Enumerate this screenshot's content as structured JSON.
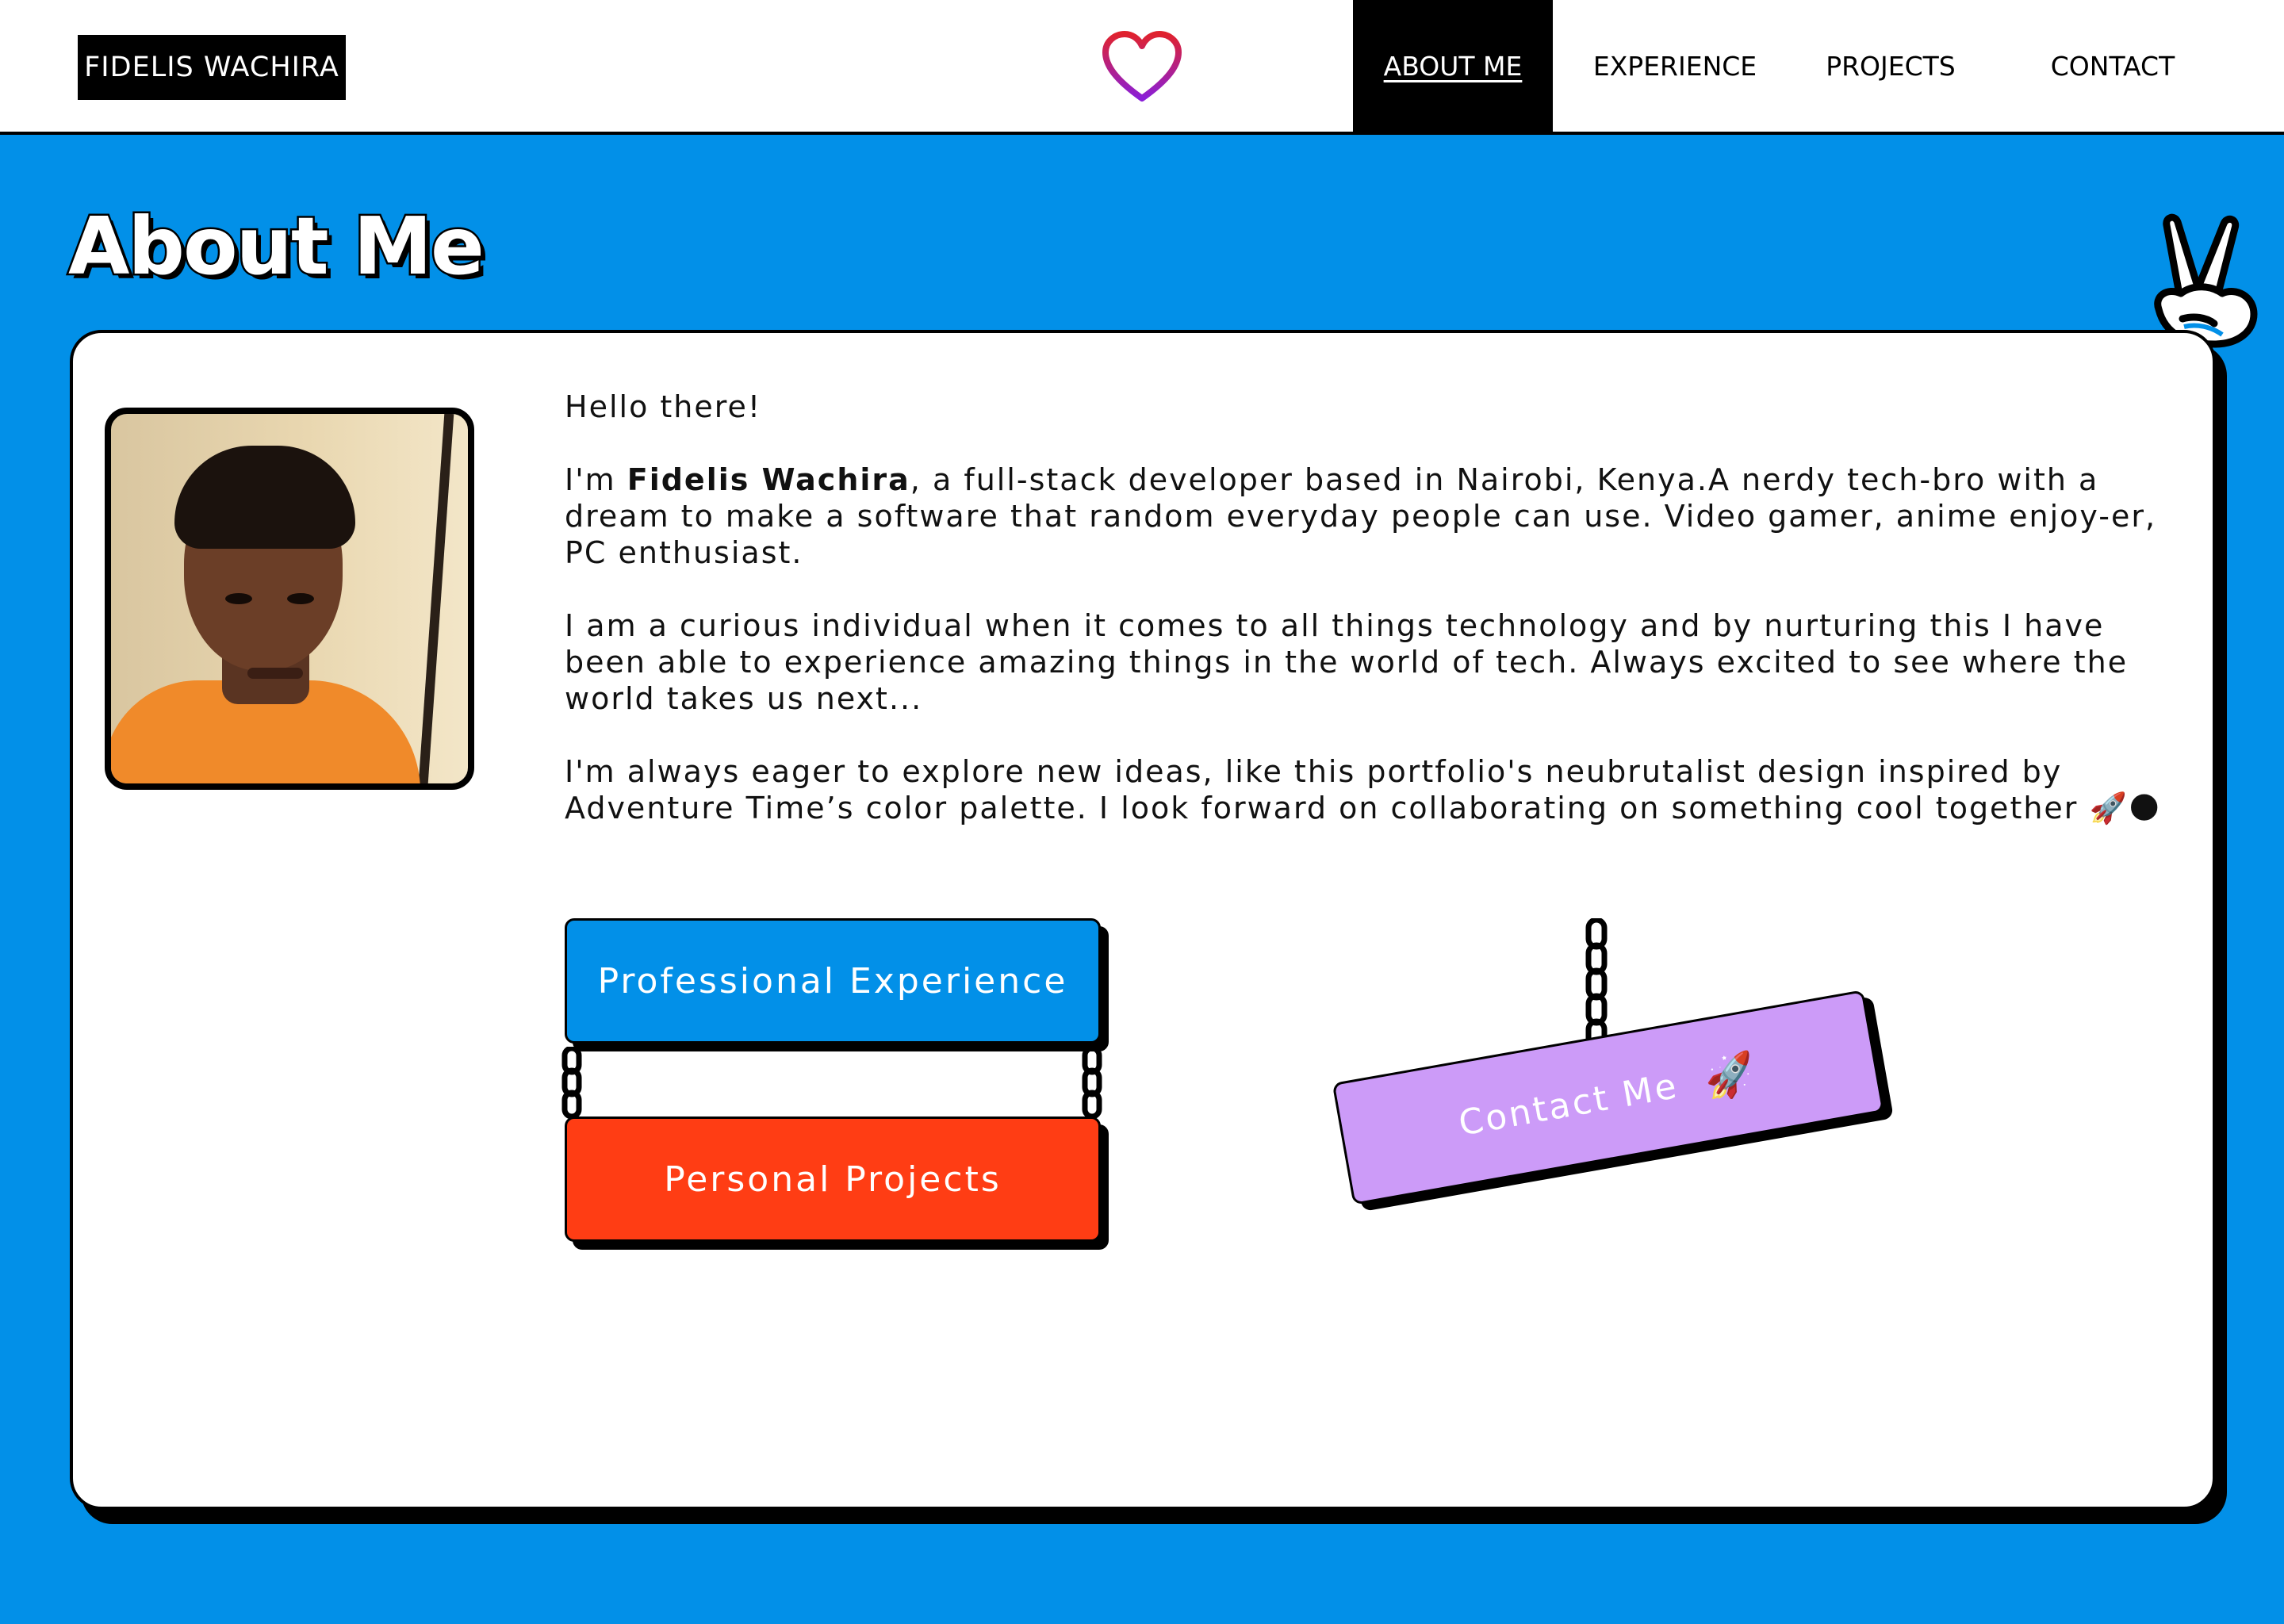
{
  "navbar": {
    "brand": "FIDELIS WACHIRA",
    "logo_icon": "heart-icon",
    "items": [
      {
        "label": "ABOUT ME",
        "active": true
      },
      {
        "label": "EXPERIENCE",
        "active": false
      },
      {
        "label": "PROJECTS",
        "active": false
      },
      {
        "label": "CONTACT",
        "active": false
      }
    ]
  },
  "page": {
    "title": "About Me",
    "decor_icon": "peace-hand-icon"
  },
  "bio": {
    "greeting": "Hello there!",
    "intro_prefix": "I'm ",
    "name": "Fidelis Wachira",
    "intro_suffix": ", a full-stack developer based in Nairobi, Kenya.A nerdy tech-bro with a dream to make a software that random everyday people can use. Video gamer, anime enjoy-er, PC enthusiast.",
    "paragraph2": "I am a curious individual when it comes to all things technology and by nurturing this I have been able to experience amazing things in the world of tech. Always excited to see where the world takes us next...",
    "paragraph3": "I'm always eager to explore new ideas, like this portfolio's neubrutalist design inspired by Adventure Time’s color palette. I look forward on collaborating on something cool together 🚀🌑"
  },
  "buttons": {
    "experience": "Professional Experience",
    "projects": "Personal Projects",
    "contact": "Contact Me",
    "contact_icon": "🚀"
  },
  "colors": {
    "background": "#0290e8",
    "experience": "#0290e8",
    "projects": "#ff3d14",
    "contact": "#cc9bf8",
    "nav_active": "#000000"
  }
}
